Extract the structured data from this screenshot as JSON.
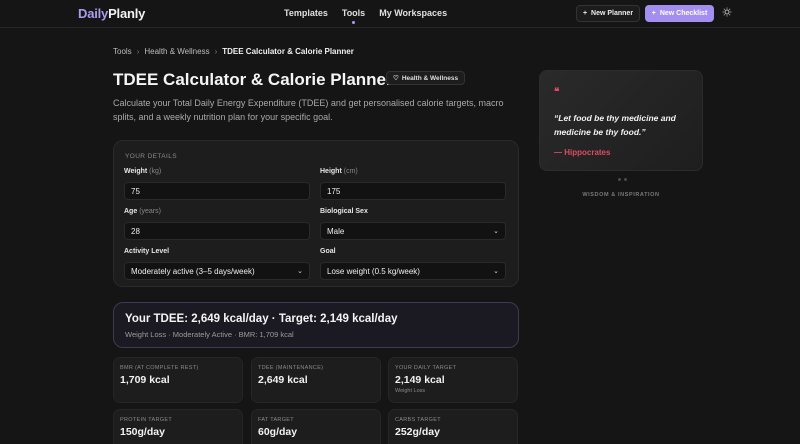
{
  "nav": {
    "logo_a": "Daily",
    "logo_b": "Planly",
    "links": [
      "Templates",
      "Tools",
      "My Workspaces"
    ],
    "new_planner": "New Planner",
    "new_checklist": "New Checklist",
    "theme_icon": "sun-icon"
  },
  "breadcrumb": [
    "Tools",
    "Health & Wellness",
    "TDEE Calculator & Calorie Planner"
  ],
  "header": {
    "title": "TDEE Calculator & Calorie Planner",
    "badge": "Health & Wellness",
    "subtitle": "Calculate your Total Daily Energy Expenditure (TDEE) and get personalised calorie targets, macro splits, and a weekly nutrition plan for your specific goal."
  },
  "form": {
    "section_label": "YOUR DETAILS",
    "weight": {
      "label": "Weight",
      "unit": "(kg)",
      "value": "75"
    },
    "height": {
      "label": "Height",
      "unit": "(cm)",
      "value": "175"
    },
    "age": {
      "label": "Age",
      "unit": "(years)",
      "value": "28"
    },
    "sex": {
      "label": "Biological Sex",
      "value": "Male"
    },
    "activity": {
      "label": "Activity Level",
      "value": "Moderately active (3–5 days/week)"
    },
    "goal": {
      "label": "Goal",
      "value": "Lose weight (0.5 kg/week)"
    }
  },
  "result": {
    "headline": "Your TDEE: 2,649 kcal/day · Target: 2,149 kcal/day",
    "summary": "Weight Loss · Moderately Active · BMR: 1,709 kcal"
  },
  "stats": [
    {
      "label": "BMR (AT COMPLETE REST)",
      "value": "1,709 kcal",
      "note": ""
    },
    {
      "label": "TDEE (MAINTENANCE)",
      "value": "2,649 kcal",
      "note": ""
    },
    {
      "label": "YOUR DAILY TARGET",
      "value": "2,149 kcal",
      "note": "Weight Loss"
    },
    {
      "label": "PROTEIN TARGET",
      "value": "150g/day",
      "note": ""
    },
    {
      "label": "FAT TARGET",
      "value": "60g/day",
      "note": ""
    },
    {
      "label": "CARBS TARGET",
      "value": "252g/day",
      "note": ""
    }
  ],
  "quote": {
    "icon": "quote-icon",
    "text": "“Let food be thy medicine and medicine be thy food.”",
    "author": "— Hippocrates",
    "caption": "WISDOM & INSPIRATION"
  },
  "colors": {
    "accent": "#a48ff0",
    "quote_accent": "#e04a62",
    "background": "#151515"
  }
}
